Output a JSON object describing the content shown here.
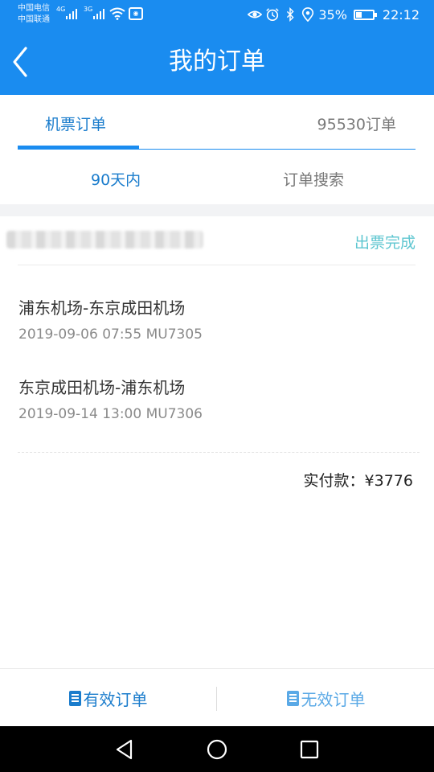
{
  "status_bar": {
    "carrier1": "中国电信",
    "carrier2": "中国联通",
    "net1": "4G",
    "net2": "3G",
    "battery_text": "35%",
    "battery_level": 0.35,
    "time": "22:12"
  },
  "header": {
    "title": "我的订单",
    "back_icon": "chevron-left-icon"
  },
  "tabs": {
    "flight_orders": "机票订单",
    "orders_95530": "95530订单",
    "active": "flight_orders"
  },
  "sub_tabs": {
    "within_90_days": "90天内",
    "order_search": "订单搜索",
    "active": "within_90_days"
  },
  "order": {
    "status": "出票完成",
    "segments": [
      {
        "route": "浦东机场-东京成田机场",
        "info": "2019-09-06 07:55 MU7305"
      },
      {
        "route": "东京成田机场-浦东机场",
        "info": "2019-09-14 13:00 MU7306"
      }
    ],
    "total": "实付款：¥3776"
  },
  "bottom_bar": {
    "valid_orders": "有效订单",
    "invalid_orders": "无效订单",
    "icon": "document-icon"
  },
  "colors": {
    "brand": "#1a8cf0",
    "active_text": "#1a7ccc",
    "status_teal": "#5ec6d0"
  },
  "nav_bar": {
    "icons": [
      "back-triangle-icon",
      "home-circle-icon",
      "recent-square-icon"
    ]
  }
}
